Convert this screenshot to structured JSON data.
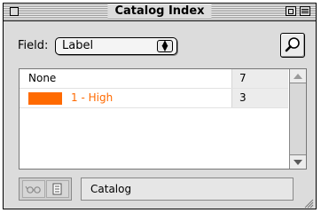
{
  "window": {
    "title": "Catalog Index"
  },
  "field": {
    "label": "Field:",
    "value": "Label"
  },
  "list": {
    "rows": [
      {
        "label": "None",
        "count": "7",
        "label_color": "#000000"
      },
      {
        "label": "1 - High",
        "count": "3",
        "label_color": "#ff6a00",
        "swatch_color": "#ff6a00"
      }
    ]
  },
  "bottom": {
    "path": "Catalog"
  },
  "icons": {
    "close": "close-box",
    "zoom": "zoom-box",
    "collapse": "collapse-box",
    "search": "magnifier-icon",
    "select": "updown-arrows-icon",
    "glasses": "glasses-icon",
    "hand": "hand-icon",
    "grow": "resize-grip-icon"
  }
}
